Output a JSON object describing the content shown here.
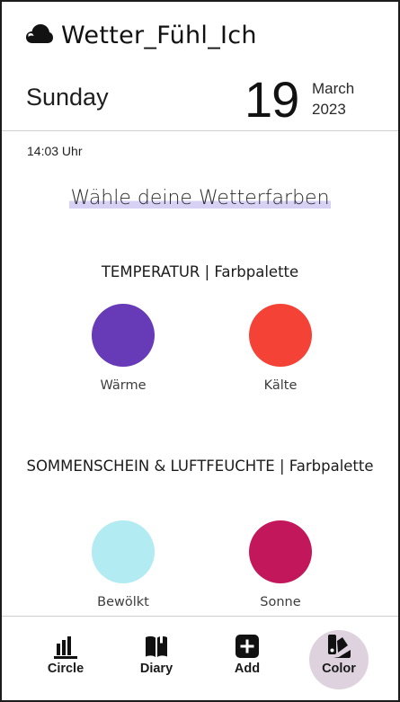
{
  "app": {
    "title": "Wetter_Fühl_Ich",
    "logo_icon": "cloud-icon"
  },
  "date": {
    "weekday": "Sunday",
    "day": "19",
    "month": "March",
    "year": "2023",
    "time": "14:03 Uhr"
  },
  "headline": "Wähle deine Wetterfarben",
  "sections": [
    {
      "title": "TEMPERATUR | Farbpalette",
      "swatches": [
        {
          "label": "Wärme",
          "color": "#673ab7"
        },
        {
          "label": "Kälte",
          "color": "#f44336"
        }
      ]
    },
    {
      "title": "SOMMENSCHEIN & LUFTFEUCHTE | Farbpalette",
      "swatches": [
        {
          "label": "Bewölkt",
          "color": "#b2ebf2"
        },
        {
          "label": "Sonne",
          "color": "#c2185b"
        }
      ]
    }
  ],
  "nav": {
    "items": [
      {
        "label": "Circle",
        "icon": "bar-chart-icon"
      },
      {
        "label": "Diary",
        "icon": "book-icon"
      },
      {
        "label": "Add",
        "icon": "add-box-icon"
      },
      {
        "label": "Color",
        "icon": "palette-icon"
      }
    ],
    "active": "Color",
    "active_color": "#ded2de"
  },
  "colors": {
    "highlight": "#d7d1f3"
  }
}
